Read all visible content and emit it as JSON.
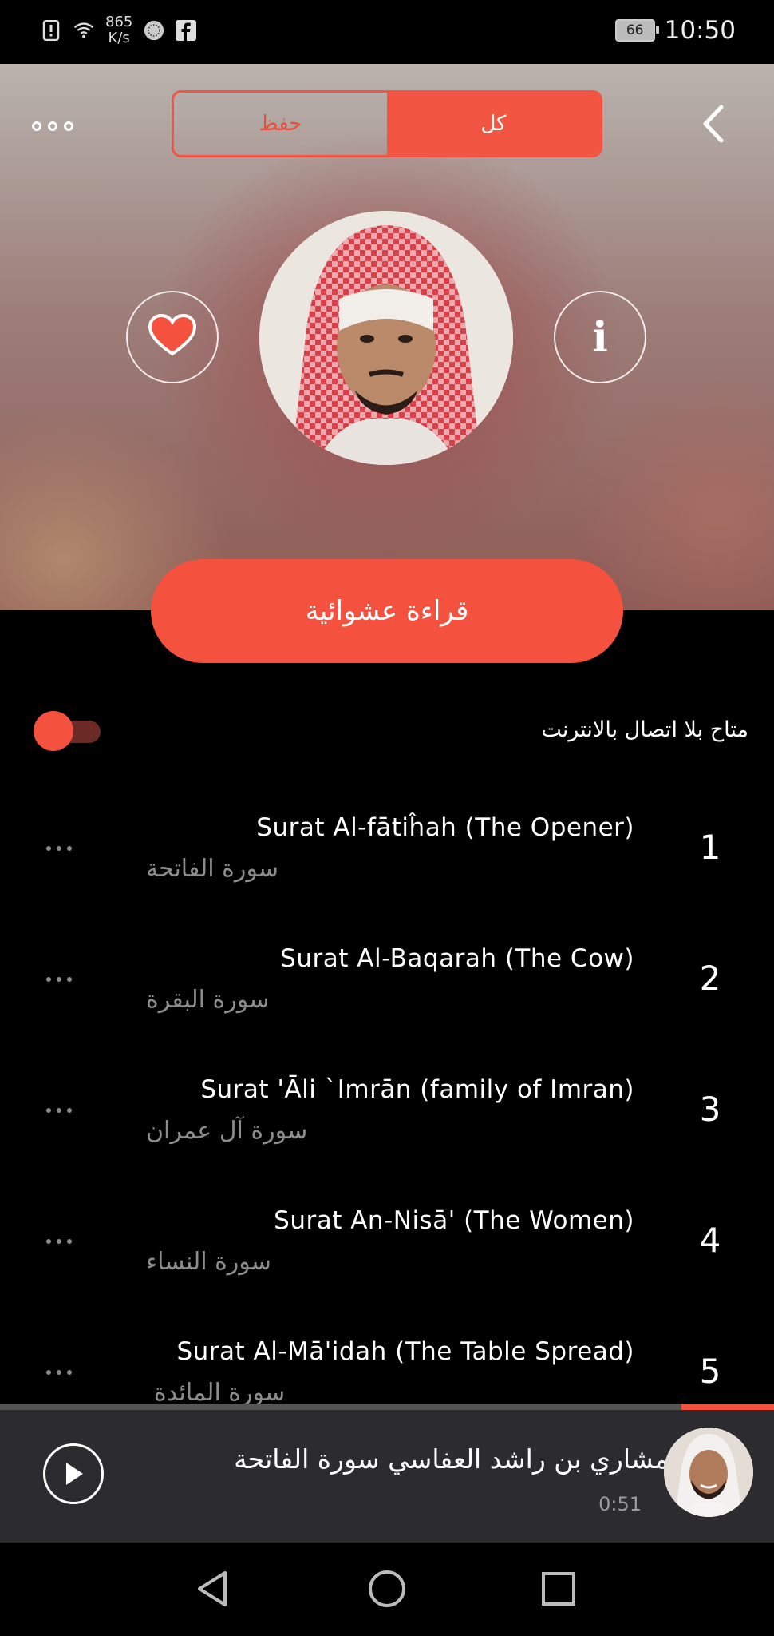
{
  "status_bar": {
    "net_speed_value": "865",
    "net_speed_unit": "K/s",
    "battery": "66",
    "time": "10:50",
    "icons": [
      "alert-icon",
      "wifi-icon",
      "app-icon",
      "facebook-icon"
    ]
  },
  "header": {
    "tabs": [
      {
        "label": "حفظ",
        "active": false
      },
      {
        "label": "كل",
        "active": true
      }
    ],
    "accent_color": "#f4523f"
  },
  "profile": {
    "favorite_icon": "heart-icon",
    "info_icon": "info-icon",
    "info_glyph": "i"
  },
  "shuffle_button": {
    "label": "قراءة عشوائية"
  },
  "offline": {
    "label": "متاح بلا اتصال بالانترنت",
    "enabled": true
  },
  "surahs": [
    {
      "number": "1",
      "title": "Surat Al-fātiĥah (The Opener)",
      "arabic": "سورة الفاتحة"
    },
    {
      "number": "2",
      "title": "Surat Al-Baqarah (The Cow)",
      "arabic": "سورة البقرة"
    },
    {
      "number": "3",
      "title": "Surat 'Āli `Imrān (family of Imran)",
      "arabic": "سورة آل عمران"
    },
    {
      "number": "4",
      "title": "Surat An-Nisā' (The Women)",
      "arabic": "سورة النساء"
    },
    {
      "number": "5",
      "title": "Surat Al-Mā'idah (The Table Spread)",
      "arabic": "سورة المائدة"
    }
  ],
  "now_playing": {
    "title": "مشاري بن راشد العفاسي سورة الفاتحة",
    "time": "0:51",
    "progress_fraction": 0.12
  },
  "nav": {
    "back": "back-icon",
    "home": "home-icon",
    "recents": "recents-icon"
  }
}
